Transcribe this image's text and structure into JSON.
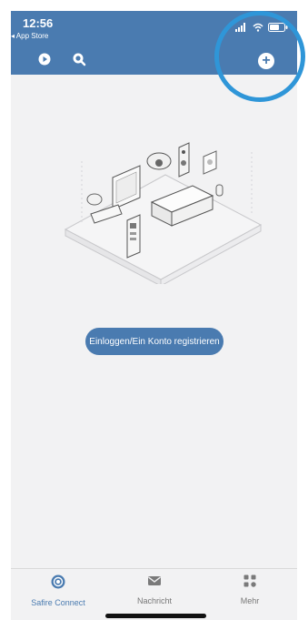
{
  "status_bar": {
    "time": "12:56",
    "back_app": "◂ App Store"
  },
  "header": {
    "icons": [
      "play-history-icon",
      "search-icon",
      "add-icon"
    ],
    "add_symbol": "+"
  },
  "main": {
    "login_label": "Einloggen/Ein Konto registrieren"
  },
  "tabbar": {
    "items": [
      {
        "label": "Safire Connect",
        "icon": "safire-connect-icon",
        "active": true
      },
      {
        "label": "Nachricht",
        "icon": "message-icon",
        "active": false
      },
      {
        "label": "Mehr",
        "icon": "more-icon",
        "active": false
      }
    ]
  },
  "colors": {
    "header": "#4a7bb0",
    "accent": "#4a7bb0",
    "overlay_circle": "#2f96d8"
  }
}
